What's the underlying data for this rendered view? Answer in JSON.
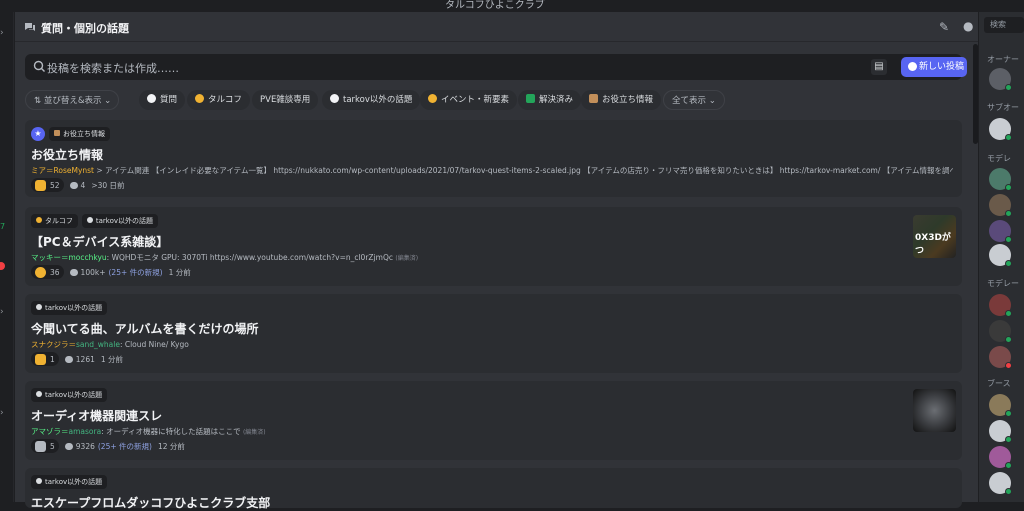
{
  "window": {
    "server_title": "タルコフひよこクラブ"
  },
  "forum": {
    "title": "質問・個別の話題"
  },
  "search": {
    "placeholder": "投稿を検索または作成……",
    "new_post_label": "新しい投稿"
  },
  "filters": {
    "sort_label": "並び替え&表示",
    "tags": [
      {
        "label": "質問",
        "color": "#f2f3f5"
      },
      {
        "label": "タルコフ",
        "color": "#f0b232"
      },
      {
        "label": "PVE雑談専用",
        "color": ""
      },
      {
        "label": "tarkov以外の話題",
        "color": "#f2f3f5"
      },
      {
        "label": "イベント・新要素",
        "color": "#f0b232"
      },
      {
        "label": "解決済み",
        "color": "#23a55a"
      },
      {
        "label": "お役立ち情報",
        "color": "#c28f5a"
      }
    ],
    "show_all_label": "全て表示"
  },
  "posts": [
    {
      "tags": [
        "お役立ち情報"
      ],
      "pinned": true,
      "title": "お役立ち情報",
      "author": "ミア＝RoseMynst",
      "preview": "> アイテム関連 【インレイド必要なアイテム一覧】 https://nukkato.com/wp-content/uploads/2021/07/tarkov-quest-items-2-scaled.jpg 【アイテムの店売り・フリマ売り価格を知りたいときは】 https://tarkov-market.com/ 【アイテム情報を調べたいとき】",
      "reaction_count": "52",
      "comments": "4",
      "new_comments": "",
      "time": ">30 日前"
    },
    {
      "tags": [
        "タルコフ",
        "tarkov以外の話題"
      ],
      "title": "【PC＆デバイス系雑談】",
      "author": "マッキー＝mocchkyu",
      "preview": ": WQHDモニタ GPU: 3070Ti https://www.youtube.com/watch?v=n_cl0rZjmQc",
      "edited": "(編集済)",
      "reaction_count": "36",
      "comments": "100k+",
      "new_comments": "(25+ 件の新規)",
      "time": "1 分前",
      "thumb_text": "0X3Dがつ"
    },
    {
      "tags": [
        "tarkov以外の話題"
      ],
      "title": "今聞いてる曲、アルバムを書くだけの場所",
      "author": "スナクジラ＝",
      "author_user": "sand_whale",
      "preview": ": Cloud Nine/ Kygo",
      "reaction_count": "1",
      "comments": "1261",
      "new_comments": "",
      "time": "1 分前"
    },
    {
      "tags": [
        "tarkov以外の話題"
      ],
      "title": "オーディオ機器関連スレ",
      "author": "アマゾラ＝",
      "author_user": "amasora",
      "preview": ": オーディオ機器に特化した話題はここで",
      "edited": "(編集済)",
      "reaction_count": "5",
      "comments": "9326",
      "new_comments": "(25+ 件の新規)",
      "time": "12 分前"
    },
    {
      "tags": [
        "tarkov以外の話題"
      ],
      "title": "エスケープフロムダッコフひよこクラブ支部"
    }
  ],
  "sidebar": {
    "search_placeholder": "検索",
    "sections": [
      "オーナー",
      "サブオー",
      "モデレ",
      "モデレー",
      "ブース"
    ]
  },
  "colors": {
    "accent": "#5865f2",
    "online": "#23a55a",
    "bg": "#313338",
    "card": "#2b2d31"
  }
}
